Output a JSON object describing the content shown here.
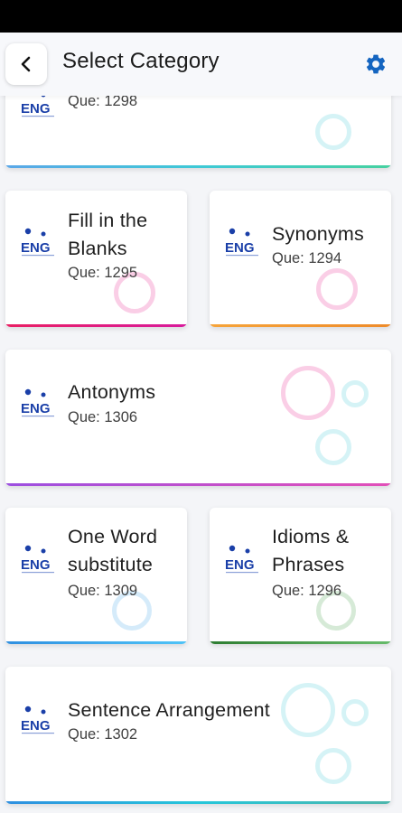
{
  "header": {
    "title": "Select Category",
    "back_icon": "chevron-left-icon",
    "settings_icon": "gear-icon",
    "accent": "#1565c0"
  },
  "logo_text": "ENG",
  "que_prefix": "Que:",
  "categories": [
    {
      "title": "",
      "que_label": "Que: 1298",
      "bar_color": "#3ec9d6"
    },
    {
      "title": "Fill in the Blanks",
      "line1": "Fill in the",
      "line2": "Blanks",
      "que_label": "Que: 1295",
      "bar_color": "#e91e8c"
    },
    {
      "title": "Synonyms",
      "que_label": "Que: 1294",
      "bar_color": "#f39b2e"
    },
    {
      "title": "Antonyms",
      "que_label": "Que: 1306",
      "bar_color": "#c653e8"
    },
    {
      "title": "One Word substitute",
      "line1": "One Word",
      "line2": "substitute",
      "que_label": "Que: 1309",
      "bar_color": "#3fa3e8"
    },
    {
      "title": "Idioms & Phrases",
      "line1": "Idioms &",
      "line2": "Phrases",
      "que_label": "Que: 1296",
      "bar_color": "#43a047"
    },
    {
      "title": "Sentence Arrangement",
      "que_label": "Que: 1302",
      "bar_color": "#26b6c6"
    }
  ]
}
